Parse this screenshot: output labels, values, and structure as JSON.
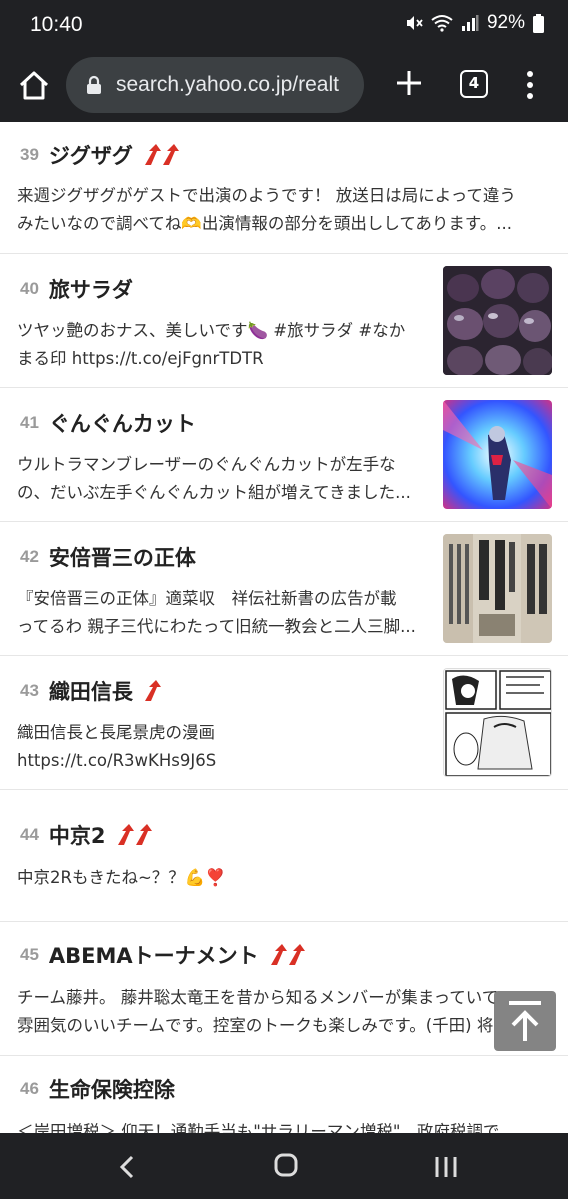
{
  "status_bar": {
    "time": "10:40",
    "battery": "92%"
  },
  "browser": {
    "url": "search.yahoo.co.jp/realt",
    "tab_count": "4"
  },
  "items": [
    {
      "rank": "39",
      "keyword": "ジグザグ",
      "trend": "double-up",
      "desc": [
        "来週ジグザグがゲストで出演のようです！ 放送日は局によって違う",
        "みたいなので調べてね🫶出演情報の部分を頭出ししてあります。..."
      ]
    },
    {
      "rank": "40",
      "keyword": "旅サラダ",
      "trend": "none",
      "desc": [
        "ツヤッ艶のおナス、美しいです🍆 #旅サラダ #なか",
        "まる印 https://t.co/ejFgnrTDTR"
      ],
      "thumb": "eggplants-photo"
    },
    {
      "rank": "41",
      "keyword": "ぐんぐんカット",
      "trend": "none",
      "desc": [
        "ウルトラマンブレーザーのぐんぐんカットが左手な",
        "の、だいぶ左手ぐんぐんカット組が増えてきました..."
      ],
      "thumb": "ultraman-photo"
    },
    {
      "rank": "42",
      "keyword": "安倍晋三の正体",
      "trend": "none",
      "desc": [
        "『安倍晋三の正体』適菜収　祥伝社新書の広告が載",
        "ってるわ 親子三代にわたって旧統一教会と二人三脚..."
      ],
      "thumb": "newspaper-ad-photo"
    },
    {
      "rank": "43",
      "keyword": "織田信長",
      "trend": "single-up",
      "desc": [
        "織田信長と長尾景虎の漫画",
        "https://t.co/R3wKHs9J6S"
      ],
      "thumb": "manga-page-image"
    },
    {
      "rank": "44",
      "keyword": "中京2",
      "trend": "double-up",
      "desc": [
        "中京2Rもきたね~？？💪❣️"
      ]
    },
    {
      "rank": "45",
      "keyword": "ABEMAトーナメント",
      "trend": "double-up",
      "desc": [
        "チーム藤井。 藤井聡太竜王を昔から知るメンバーが集まっていて",
        "雰囲気のいいチームです。控室のトークも楽しみです。(千田) 将"
      ]
    },
    {
      "rank": "46",
      "keyword": "生命保険控除",
      "trend": "none",
      "desc": [
        "＜岸田増税＞ 仰天！通勤手当も\"サラリーマン増税\"　政府税調で"
      ]
    }
  ],
  "colors": {
    "trend_arrow": "#d93025",
    "system_bar": "#202124",
    "url_pill": "#3c4043"
  }
}
